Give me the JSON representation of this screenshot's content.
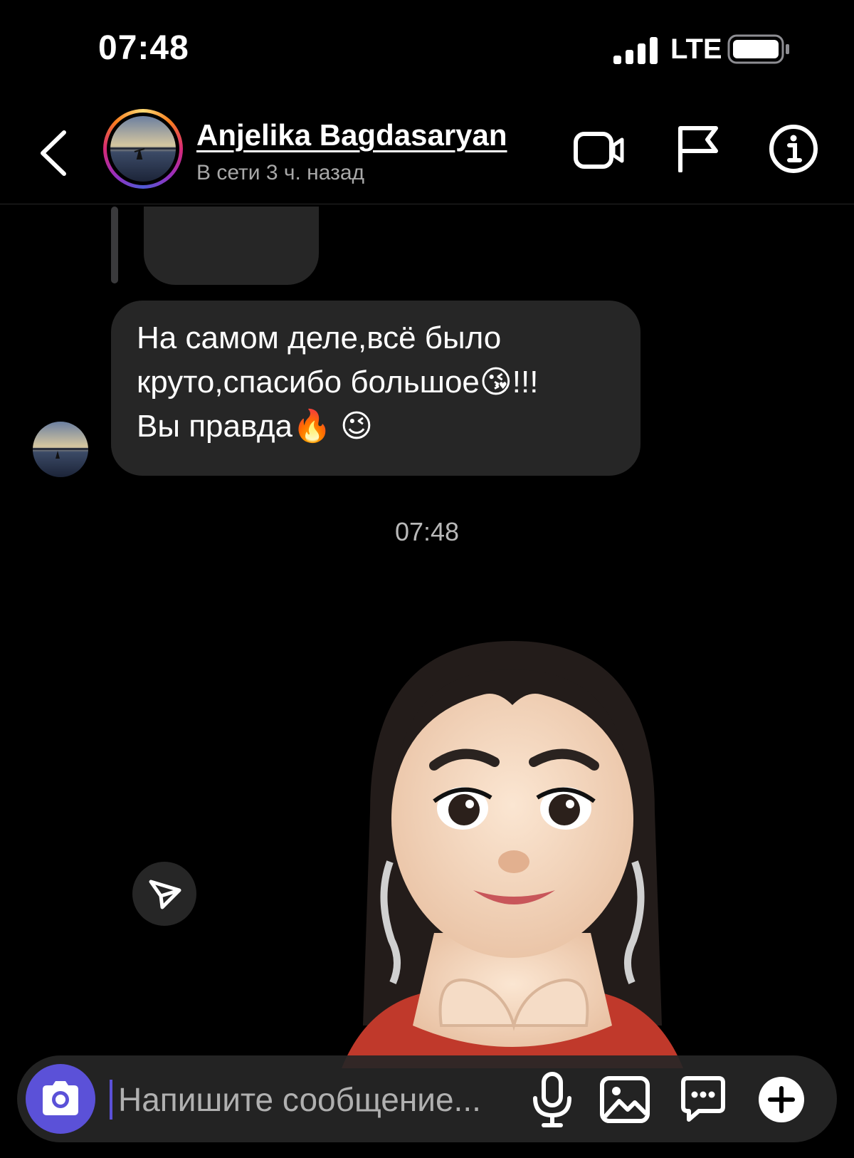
{
  "status_bar": {
    "time": "07:48",
    "network": "LTE",
    "icons": [
      "signal-icon",
      "battery-icon"
    ]
  },
  "header": {
    "contact_name": "Anjelika Bagdasaryan",
    "contact_status": "В сети 3 ч. назад",
    "icons": [
      "back-chevron-icon",
      "video-call-icon",
      "flag-icon",
      "info-icon"
    ]
  },
  "chat": {
    "message_text": "На самом деле,всё было\nкруто,спасибо большое😘!!!\nВы правда🔥 😉",
    "timestamp": "07:48"
  },
  "composer": {
    "placeholder": "Напишите сообщение...",
    "icons": [
      "camera-icon",
      "microphone-icon",
      "gallery-icon",
      "sticker-icon",
      "plus-icon"
    ]
  },
  "colors": {
    "background": "#000000",
    "bubble": "#262626",
    "accent": "#5b51d8",
    "muted_text": "#a8a8a8"
  }
}
